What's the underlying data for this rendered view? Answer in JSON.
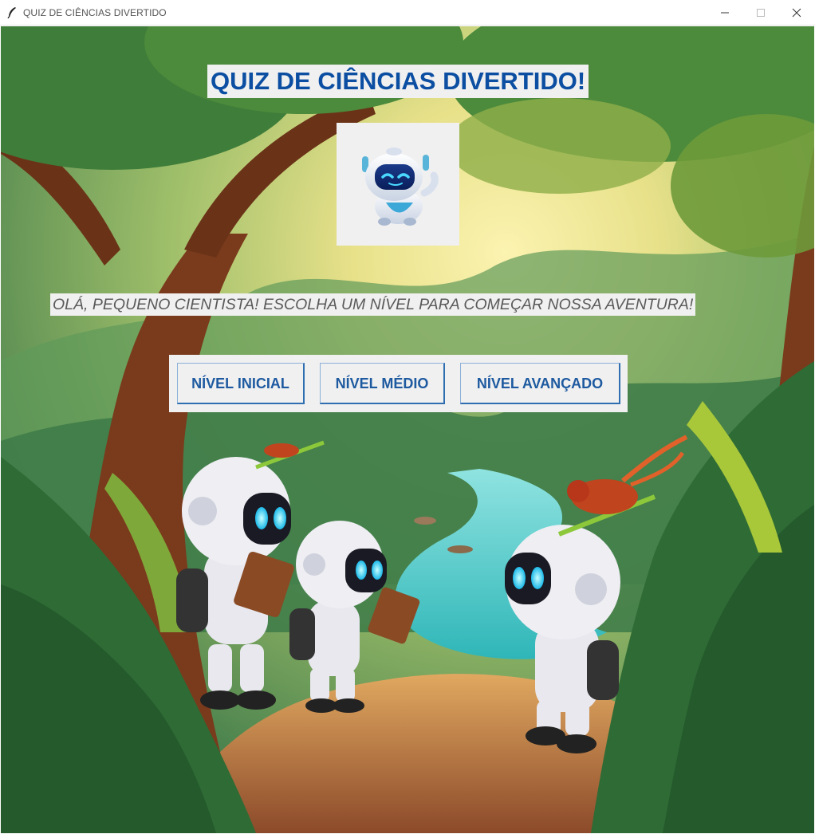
{
  "window": {
    "title": "QUIZ DE CIÊNCIAS DIVERTIDO",
    "controls": [
      "minimize-icon",
      "maximize-icon",
      "close-icon"
    ]
  },
  "main": {
    "title": "QUIZ DE CIÊNCIAS DIVERTIDO!",
    "welcome": "OLÁ, PEQUENO CIENTISTA! ESCOLHA UM NÍVEL PARA COMEÇAR NOSSA AVENTURA!",
    "mascot_icon": "robot-mascot-icon",
    "levels": [
      {
        "label": "NÍVEL INICIAL"
      },
      {
        "label": "NÍVEL MÉDIO"
      },
      {
        "label": "NÍVEL AVANÇADO"
      }
    ]
  },
  "colors": {
    "title_text": "#0b4ea2",
    "button_text": "#1e5aa0",
    "panel_bg": "#f0f0f0",
    "welcome_text": "#5a5a5a"
  }
}
